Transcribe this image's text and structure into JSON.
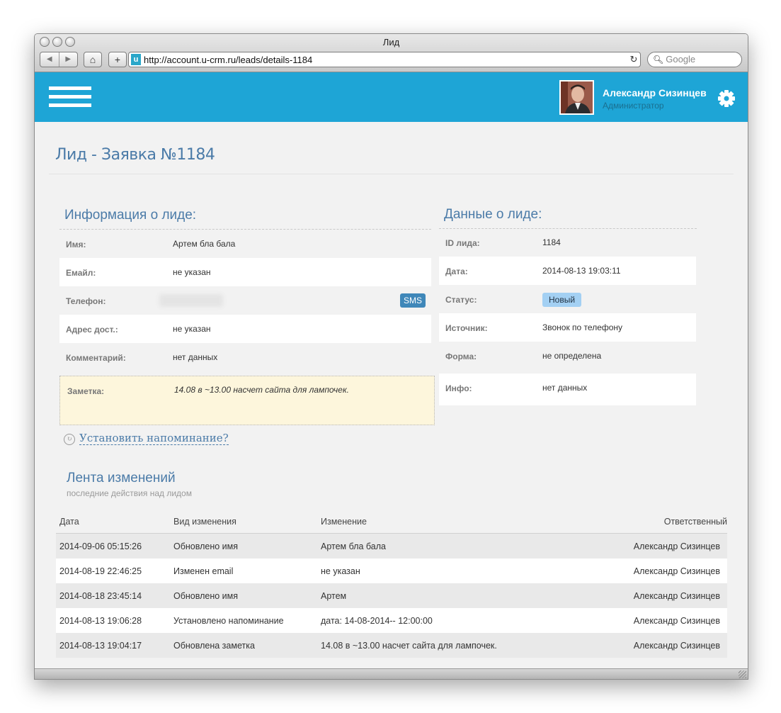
{
  "browser": {
    "window_title": "Лид",
    "url": "http://account.u-crm.ru/leads/details-1184",
    "search_placeholder": "Google",
    "back_icon": "◀",
    "forward_icon": "▶",
    "home_icon": "⌂",
    "add_icon": "+",
    "reload_icon": "↻",
    "favicon": "u"
  },
  "header": {
    "accent_color": "#1ea5d6",
    "user_name": "Александр Сизинцев",
    "user_role": "Администратор"
  },
  "page": {
    "title": "Лид - Заявка №1184"
  },
  "lead_info": {
    "title": "Информация о лиде:",
    "name_label": "Имя:",
    "name_value": "Артем бла бала",
    "email_label": "Емайл:",
    "email_value": "не указан",
    "phone_label": "Телефон:",
    "sms_label": "SMS",
    "address_label": "Адрес дост.:",
    "address_value": "не указан",
    "comment_label": "Комментарий:",
    "comment_value": "нет данных",
    "note_label": "Заметка:",
    "note_value": "14.08 в ~13.00 насчет сайта для лампочек."
  },
  "lead_data": {
    "title": "Данные о лиде:",
    "id_label": "ID лида:",
    "id_value": "1184",
    "date_label": "Дата:",
    "date_value": "2014-08-13 19:03:11",
    "status_label": "Статус:",
    "status_value": "Новый",
    "source_label": "Источник:",
    "source_value": "Звонок по телефону",
    "form_label": "Форма:",
    "form_value": "не определена",
    "info_label": "Инфо:",
    "info_value": "нет данных"
  },
  "reminder": {
    "link": "Установить напоминание?"
  },
  "feed": {
    "title": "Лента изменений",
    "subtitle": "последние действия над лидом",
    "columns": [
      "Дата",
      "Вид изменения",
      "Изменение",
      "Ответственный"
    ],
    "rows": [
      [
        "2014-09-06 05:15:26",
        "Обновлено имя",
        "Артем бла бала",
        "Александр Сизинцев"
      ],
      [
        "2014-08-19 22:46:25",
        "Изменен email",
        "не указан",
        "Александр Сизинцев"
      ],
      [
        "2014-08-18 23:45:14",
        "Обновлено имя",
        "Артем",
        "Александр Сизинцев"
      ],
      [
        "2014-08-13 19:06:28",
        "Установлено напоминание",
        "дата: 14-08-2014-- 12:00:00",
        "Александр Сизинцев"
      ],
      [
        "2014-08-13 19:04:17",
        "Обновлена заметка",
        "14.08 в ~13.00 насчет сайта для лампочек.",
        "Александр Сизинцев"
      ]
    ]
  }
}
